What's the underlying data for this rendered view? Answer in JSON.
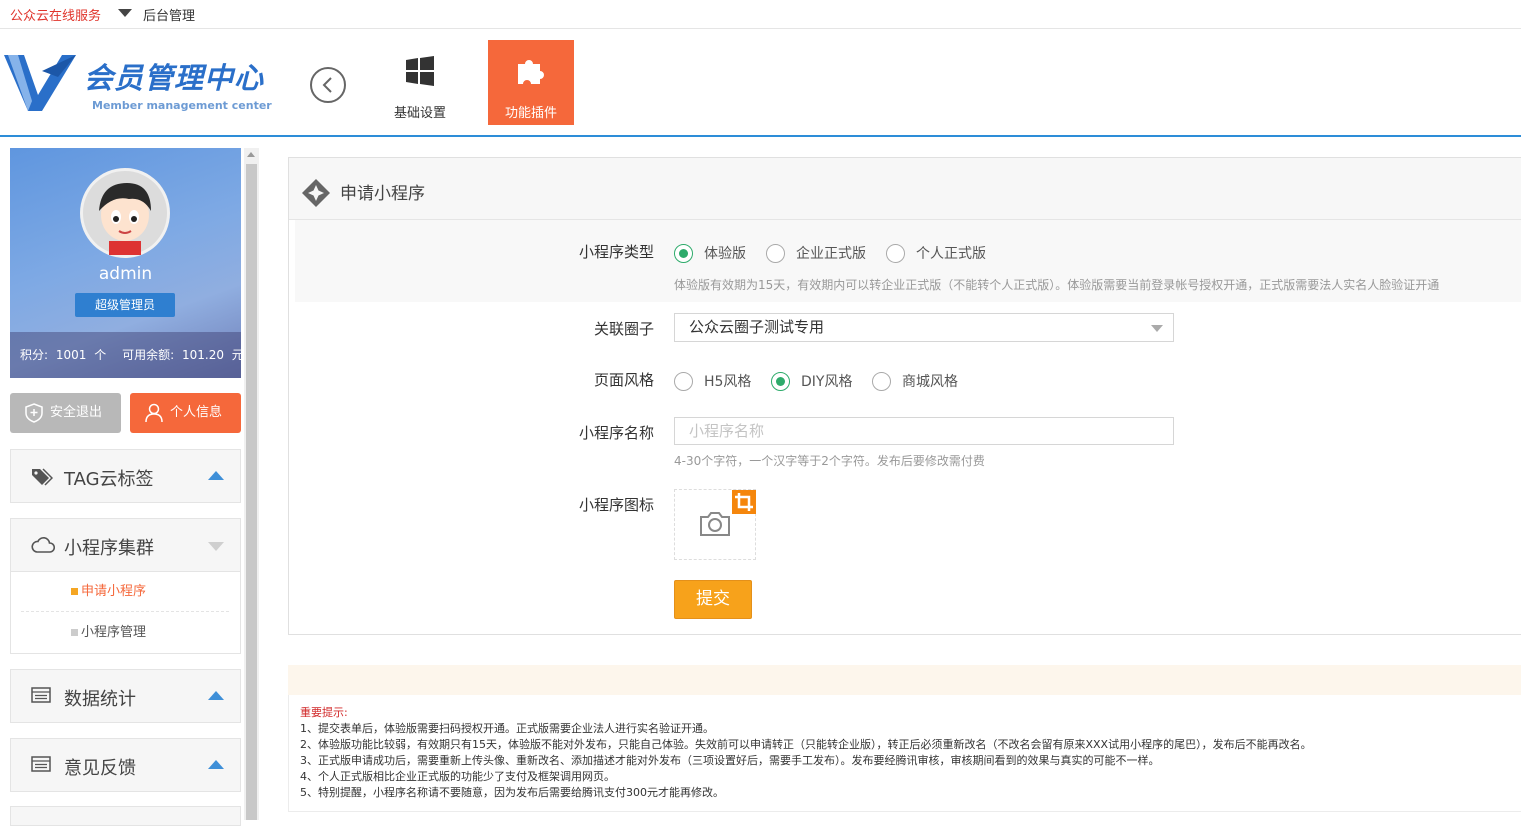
{
  "topbar": {
    "brand": "公众云在线服务",
    "admin_link": "后台管理"
  },
  "header": {
    "logo_cn": "会员管理中心",
    "logo_en": "Member management center",
    "nav": [
      {
        "label": "基础设置",
        "icon": "windows-icon",
        "active": false
      },
      {
        "label": "功能插件",
        "icon": "puzzle-icon",
        "active": true
      }
    ]
  },
  "profile": {
    "username": "admin",
    "role": "超级管理员",
    "points_label": "积分:",
    "points_value": "1001",
    "points_unit": "个",
    "balance_label": "可用余额:",
    "balance_value": "101.20",
    "balance_unit": "元"
  },
  "actions": {
    "logout": "安全退出",
    "profile": "个人信息"
  },
  "sidebar": {
    "menus": [
      {
        "label": "TAG云标签",
        "icon": "tag-icon",
        "expanded": false
      },
      {
        "label": "小程序集群",
        "icon": "cloud-icon",
        "expanded": true,
        "children": [
          {
            "label": "申请小程序",
            "active": true
          },
          {
            "label": "小程序管理",
            "active": false
          }
        ]
      },
      {
        "label": "数据统计",
        "icon": "list-icon",
        "expanded": false
      },
      {
        "label": "意见反馈",
        "icon": "list-icon",
        "expanded": false
      }
    ]
  },
  "form": {
    "title": "申请小程序",
    "type": {
      "label": "小程序类型",
      "options": [
        "体验版",
        "企业正式版",
        "个人正式版"
      ],
      "selected": "体验版",
      "hint": "体验版有效期为15天，有效期内可以转企业正式版（不能转个人正式版）。体验版需要当前登录帐号授权开通，正式版需要法人实名人脸验证开通"
    },
    "circle": {
      "label": "关联圈子",
      "value": "公众云圈子测试专用"
    },
    "style": {
      "label": "页面风格",
      "options": [
        "H5风格",
        "DIY风格",
        "商城风格"
      ],
      "selected": "DIY风格"
    },
    "name": {
      "label": "小程序名称",
      "placeholder": "小程序名称",
      "value": "",
      "hint": "4-30个字符，一个汉字等于2个字符。发布后要修改需付费"
    },
    "icon": {
      "label": "小程序图标"
    },
    "submit": "提交"
  },
  "notice": {
    "title": "重要提示:",
    "items": [
      "1、提交表单后，体验版需要扫码授权开通。正式版需要企业法人进行实名验证开通。",
      "2、体验版功能比较弱，有效期只有15天，体验版不能对外发布，只能自己体验。失效前可以申请转正（只能转企业版），转正后必须重新改名（不改名会留有原来XXX试用小程序的尾巴），发布后不能再改名。",
      "3、正式版申请成功后，需要重新上传头像、重新改名、添加描述才能对外发布（三项设置好后，需要手工发布）。发布要经腾讯审核，审核期间看到的效果与真实的可能不一样。",
      "4、个人正式版相比企业正式版的功能少了支付及框架调用网页。",
      "5、特别提醒，小程序名称请不要随意，因为发布后需要给腾讯支付300元才能再修改。"
    ]
  },
  "colors": {
    "accent_orange": "#f5683b",
    "submit_orange": "#f7a21b",
    "radio_green": "#2eab6b",
    "brand_blue": "#2a6fc9",
    "header_line": "#2d8dd8"
  }
}
